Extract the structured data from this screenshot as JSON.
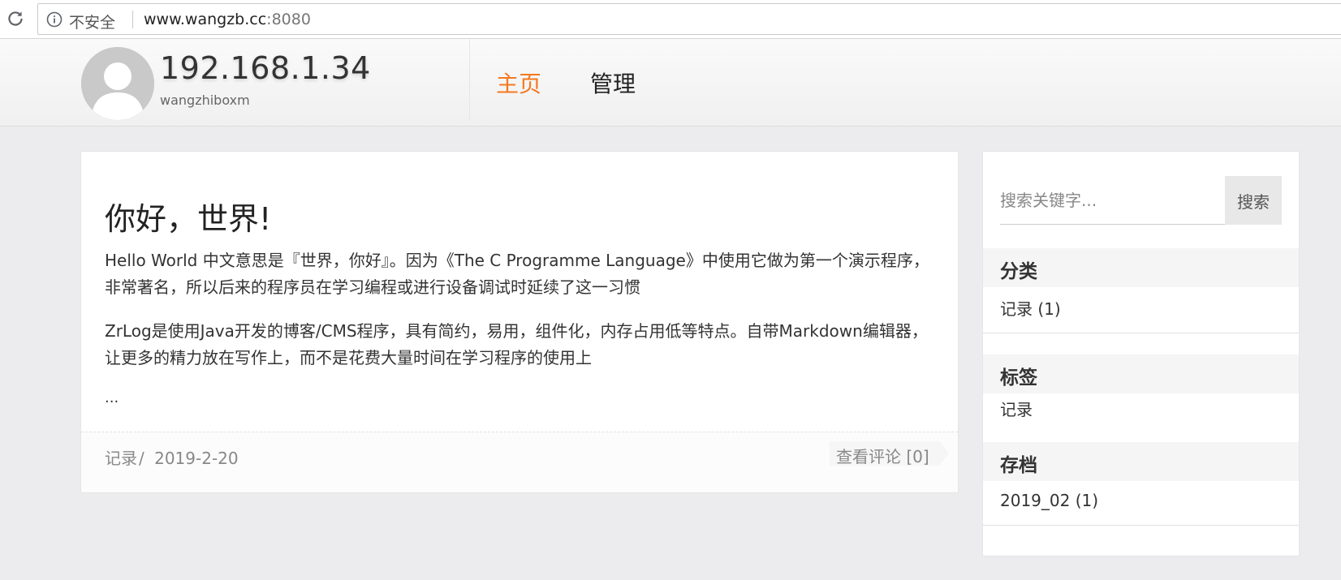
{
  "browser": {
    "security_label": "不安全",
    "url_host": "www.wangzb.cc",
    "url_port": ":8080"
  },
  "header": {
    "site_title": "192.168.1.34",
    "site_subtitle": "wangzhiboxm",
    "nav": [
      {
        "label": "主页",
        "active": true
      },
      {
        "label": "管理",
        "active": false
      }
    ],
    "accent_color": "#f47920"
  },
  "post": {
    "title": "你好，世界!",
    "paragraphs": [
      "Hello World 中文意思是『世界，你好』。因为《The C Programme Language》中使用它做为第一个演示程序，非常著名，所以后来的程序员在学习编程或进行设备调试时延续了这一习惯",
      "ZrLog是使用Java开发的博客/CMS程序，具有简约，易用，组件化，内存占用低等特点。自带Markdown编辑器，让更多的精力放在写作上，而不是花费大量时间在学习程序的使用上"
    ],
    "ellipsis": "...",
    "category": "记录",
    "separator": "/",
    "date": "2019-2-20",
    "comments_label": "查看评论 [0]"
  },
  "sidebar": {
    "search_placeholder": "搜索关键字...",
    "search_button": "搜索",
    "categories_title": "分类",
    "categories": [
      "记录 (1)"
    ],
    "tags_title": "标签",
    "tags": [
      "记录"
    ],
    "archives_title": "存档",
    "archives": [
      "2019_02 (1)"
    ]
  }
}
